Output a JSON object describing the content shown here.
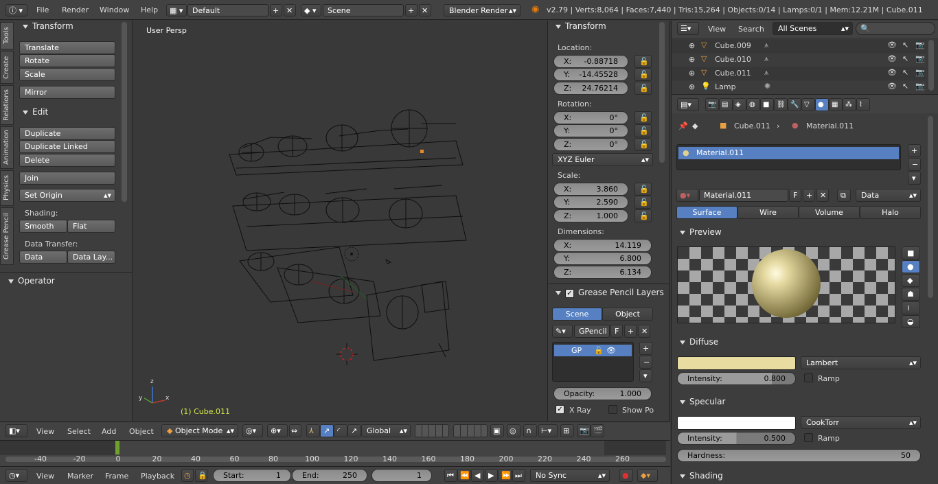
{
  "topbar": {
    "menus": [
      "File",
      "Render",
      "Window",
      "Help"
    ],
    "layout": "Default",
    "scene": "Scene",
    "engine": "Blender Render",
    "stats": "v2.79 | Verts:8,064 | Faces:7,440 | Tris:15,264 | Objects:0/14 | Lamps:0/1 | Mem:12.21M | Cube.011"
  },
  "tools": {
    "tabs": [
      "Tools",
      "Create",
      "Relations",
      "Animation",
      "Physics",
      "Grease Pencil"
    ],
    "transform_title": "Transform",
    "translate": "Translate",
    "rotate": "Rotate",
    "scale": "Scale",
    "mirror": "Mirror",
    "edit_title": "Edit",
    "duplicate": "Duplicate",
    "duplicate_linked": "Duplicate Linked",
    "delete": "Delete",
    "join": "Join",
    "set_origin": "Set Origin",
    "shading_label": "Shading:",
    "smooth": "Smooth",
    "flat": "Flat",
    "data_transfer_label": "Data Transfer:",
    "data": "Data",
    "data_layout": "Data Lay...",
    "operator_title": "Operator"
  },
  "viewport": {
    "view_label": "User Persp",
    "object_label": "(1) Cube.011",
    "axis_x": "x",
    "axis_y": "y",
    "axis_z": "z"
  },
  "npanel": {
    "title": "Transform",
    "location_label": "Location:",
    "location": [
      {
        "k": "X:",
        "v": "-0.88718"
      },
      {
        "k": "Y:",
        "v": "-14.45528"
      },
      {
        "k": "Z:",
        "v": "24.76214"
      }
    ],
    "rotation_label": "Rotation:",
    "rotation": [
      {
        "k": "X:",
        "v": "0°"
      },
      {
        "k": "Y:",
        "v": "0°"
      },
      {
        "k": "Z:",
        "v": "0°"
      }
    ],
    "rotation_mode": "XYZ Euler",
    "scale_label": "Scale:",
    "scale": [
      {
        "k": "X:",
        "v": "3.860"
      },
      {
        "k": "Y:",
        "v": "2.590"
      },
      {
        "k": "Z:",
        "v": "1.000"
      }
    ],
    "dimensions_label": "Dimensions:",
    "dimensions": [
      {
        "k": "X:",
        "v": "14.119"
      },
      {
        "k": "Y:",
        "v": "6.800"
      },
      {
        "k": "Z:",
        "v": "6.134"
      }
    ],
    "gp_layers_title": "Grease Pencil Layers",
    "gp_scene": "Scene",
    "gp_object": "Object",
    "gpencil": "GPencil",
    "gpencil_f": "F",
    "gp_layer": "GP",
    "opacity_label": "Opacity:",
    "opacity": "1.000",
    "xray": "X Ray",
    "showpo": "Show Po"
  },
  "viewheader": {
    "view": "View",
    "select": "Select",
    "add": "Add",
    "object": "Object",
    "mode": "Object Mode",
    "orientation": "Global"
  },
  "timeline": {
    "ticks": [
      "-40",
      "-20",
      "0",
      "20",
      "40",
      "60",
      "80",
      "100",
      "120",
      "140",
      "160",
      "180",
      "200",
      "220",
      "240",
      "260"
    ],
    "view": "View",
    "marker": "Marker",
    "frame": "Frame",
    "playback": "Playback",
    "start_label": "Start:",
    "start": "1",
    "end_label": "End:",
    "end": "250",
    "current": "1",
    "sync": "No Sync"
  },
  "outliner": {
    "view": "View",
    "search": "Search",
    "filter": "All Scenes",
    "items": [
      "Cube.009",
      "Cube.010",
      "Cube.011",
      "Lamp"
    ]
  },
  "properties": {
    "object": "Cube.011",
    "material": "Material.011",
    "slot": "Material.011",
    "mat_name": "Material.011",
    "mat_f": "F",
    "data": "Data",
    "tabs": [
      "Surface",
      "Wire",
      "Volume",
      "Halo"
    ],
    "preview_title": "Preview",
    "diffuse_title": "Diffuse",
    "diffuse_color": "#e8dca0",
    "diffuse_shader": "Lambert",
    "diffuse_intensity_label": "Intensity:",
    "diffuse_intensity": "0.800",
    "diffuse_intensity_fraction": 0.8,
    "ramp": "Ramp",
    "specular_title": "Specular",
    "specular_color": "#ffffff",
    "specular_shader": "CookTorr",
    "specular_intensity_label": "Intensity:",
    "specular_intensity": "0.500",
    "specular_intensity_fraction": 0.5,
    "hardness_label": "Hardness:",
    "hardness": "50",
    "shading_title": "Shading"
  }
}
